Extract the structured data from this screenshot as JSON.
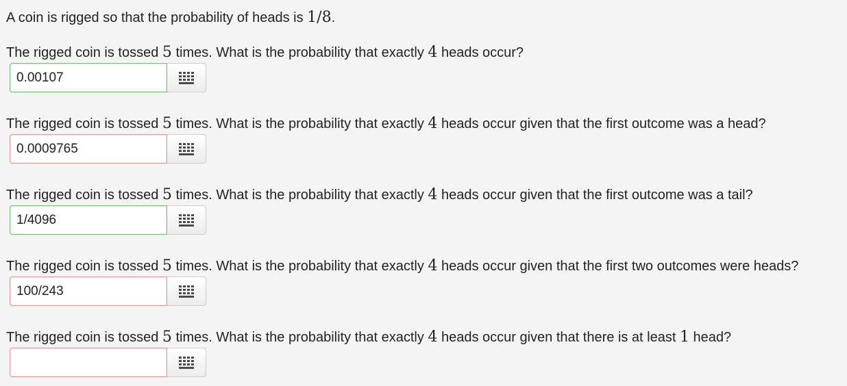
{
  "intro": {
    "prefix": "A coin is rigged so that the probability of heads is ",
    "math": "1/8",
    "suffix": "."
  },
  "questions": [
    {
      "part1": "The rigged coin is tossed ",
      "n": "5",
      "part2": " times. What is the probability that exactly ",
      "k": "4",
      "part3": " heads occur?",
      "answer": "0.00107",
      "status": "correct"
    },
    {
      "part1": "The rigged coin is tossed ",
      "n": "5",
      "part2": " times. What is the probability that exactly ",
      "k": "4",
      "part3": " heads occur given that the first outcome was a head?",
      "answer": "0.0009765",
      "status": "incorrect"
    },
    {
      "part1": "The rigged coin is tossed ",
      "n": "5",
      "part2": " times. What is the probability that exactly ",
      "k": "4",
      "part3": " heads occur given that the first outcome was a tail?",
      "answer": "1/4096",
      "status": "correct"
    },
    {
      "part1": "The rigged coin is tossed ",
      "n": "5",
      "part2": " times. What is the probability that exactly ",
      "k": "4",
      "part3": " heads occur given that the first two outcomes were heads?",
      "answer": "100/243",
      "status": "incorrect"
    },
    {
      "part1": "The rigged coin is tossed ",
      "n": "5",
      "part2": " times. What is the probability that exactly ",
      "k": "4",
      "part3": " heads occur given that there is at least ",
      "m": "1",
      "part4": " head?",
      "answer": "",
      "status": "incorrect"
    }
  ],
  "keypad": {
    "icon": "keypad-grid-icon",
    "color": "#4a4a4a"
  },
  "colors": {
    "correct_border": "#7cba7c",
    "incorrect_border": "#d99a9a",
    "background": "#f4f4f4"
  }
}
